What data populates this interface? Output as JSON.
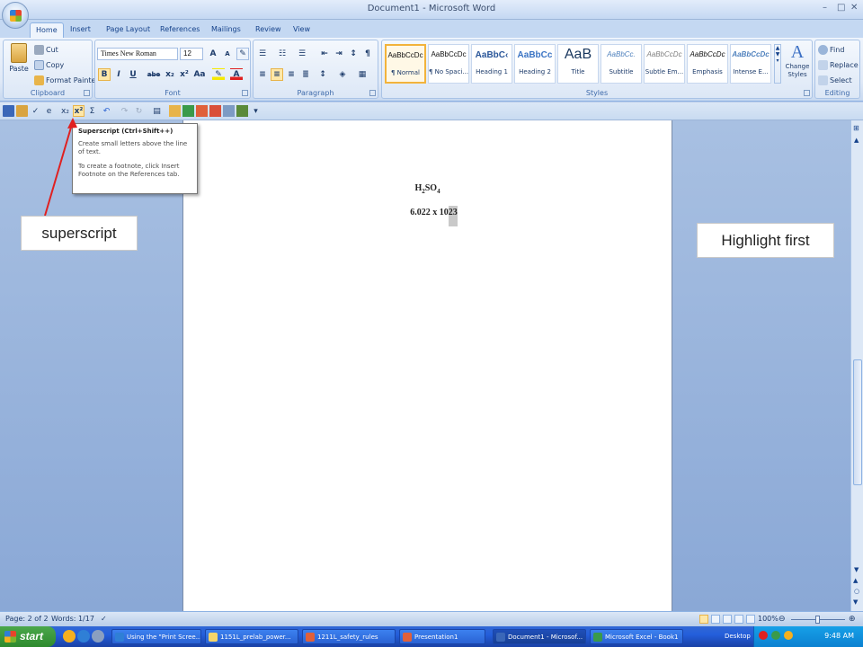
{
  "window": {
    "title": "Document1 - Microsoft Word",
    "controls": [
      "–",
      "□",
      "✕"
    ]
  },
  "tabs": [
    "Home",
    "Insert",
    "Page Layout",
    "References",
    "Mailings",
    "Review",
    "View"
  ],
  "ribbon": {
    "clipboard": {
      "label": "Clipboard",
      "paste": "Paste",
      "cut": "Cut",
      "copy": "Copy",
      "format_painter": "Format Painter"
    },
    "font": {
      "label": "Font",
      "font_name": "Times New Roman",
      "font_size": "12",
      "buttons": [
        "B",
        "I",
        "U",
        "abe",
        "x₂",
        "x²",
        "Aa"
      ]
    },
    "paragraph": {
      "label": "Paragraph"
    },
    "styles": {
      "label": "Styles",
      "items": [
        {
          "preview": "AaBbCcDc",
          "name": "¶ Normal"
        },
        {
          "preview": "AaBbCcDc",
          "name": "¶ No Spaci..."
        },
        {
          "preview": "AaBbC‹",
          "name": "Heading 1"
        },
        {
          "preview": "AaBbCc",
          "name": "Heading 2"
        },
        {
          "preview": "AaB",
          "name": "Title"
        },
        {
          "preview": "AaBbCc.",
          "name": "Subtitle"
        },
        {
          "preview": "AaBbCcDc",
          "name": "Subtle Em..."
        },
        {
          "preview": "AaBbCcDc",
          "name": "Emphasis"
        },
        {
          "preview": "AaBbCcDc",
          "name": "Intense E..."
        }
      ],
      "change_styles": "Change Styles"
    },
    "editing": {
      "label": "Editing",
      "find": "Find",
      "replace": "Replace",
      "select": "Select"
    }
  },
  "qat": {
    "sigma": "Σ",
    "superscript": "x²",
    "subscript": "x₂"
  },
  "tooltip": {
    "title": "Superscript (Ctrl+Shift++)",
    "body": "Create small letters above the line of text.",
    "hint": "To create a footnote, click Insert Footnote on the References tab."
  },
  "document": {
    "formula_main": "H",
    "formula_sub": "2",
    "formula_rest": "SO",
    "formula_sub2": "4",
    "line2_before": "6.022 x 10",
    "line2_highlight": "23"
  },
  "callouts": {
    "left": "superscript",
    "right": "Highlight first"
  },
  "statusbar": {
    "page": "Page: 2 of 2",
    "words": "Words: 1/17",
    "zoom": "100%"
  },
  "taskbar": {
    "start": "start",
    "items": [
      "Using the \"Print Scree...",
      "1151L_prelab_power...",
      "1211L_safety_rules",
      "Presentation1",
      "Document1 - Microsof...",
      "Microsoft Excel - Book1"
    ],
    "desktop": "Desktop",
    "clock": "9:48 AM"
  },
  "colors": {
    "accent": "#f2b33b",
    "arrow": "#e02020",
    "ribbon_text": "#15428b"
  }
}
